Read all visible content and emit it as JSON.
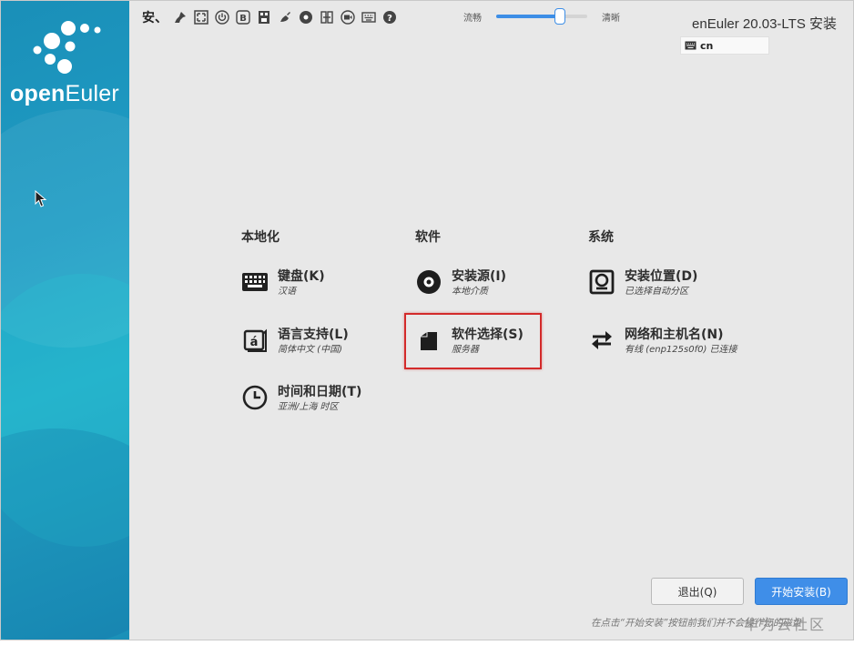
{
  "sidebar": {
    "logo_bold": "open",
    "logo_light": "Euler"
  },
  "toolbar": {
    "title": "安、",
    "icons": [
      "pin-icon",
      "fullscreen-icon",
      "power-icon",
      "bold-b-icon",
      "usb-icon",
      "brush-icon",
      "record-icon",
      "transfer-icon",
      "video-icon",
      "keyboard-icon",
      "help-icon"
    ],
    "slider": {
      "left_label": "流畅",
      "right_label": "清晰",
      "value_fraction": 0.7
    }
  },
  "header": {
    "product": "enEuler 20.03-LTS 安装",
    "keyboard_layout": "cn"
  },
  "hub": {
    "categories": [
      "本地化",
      "软件",
      "系统"
    ],
    "localization": [
      {
        "title": "键盘(K)",
        "status": "汉语",
        "icon": "keyboard-icon"
      },
      {
        "title": "语言支持(L)",
        "status": "简体中文 (中国)",
        "icon": "language-icon"
      },
      {
        "title": "时间和日期(T)",
        "status": "亚洲/上海 时区",
        "icon": "clock-icon"
      }
    ],
    "software": [
      {
        "title": "安装源(I)",
        "status": "本地介质",
        "icon": "disc-icon"
      },
      {
        "title": "软件选择(S)",
        "status": "服务器",
        "icon": "package-icon"
      }
    ],
    "system": [
      {
        "title": "安装位置(D)",
        "status": "已选择自动分区",
        "icon": "harddisk-icon"
      },
      {
        "title": "网络和主机名(N)",
        "status": "有线 (enp125s0f0) 已连接",
        "icon": "network-arrows-icon"
      }
    ]
  },
  "footer": {
    "quit_label": "退出(Q)",
    "start_label": "开始安装(B)",
    "note": "在点击“开始安装”按钮前我们并不会操作您的磁盘",
    "watermark": "华为云社区"
  },
  "colors": {
    "accent": "#3f8ee8",
    "highlight": "#d32a2a",
    "sidebar": "#1f9cc4"
  }
}
